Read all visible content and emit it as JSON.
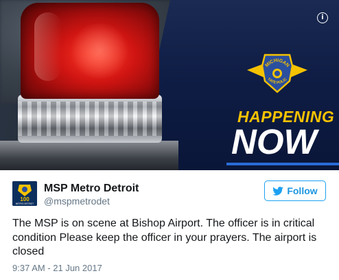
{
  "media": {
    "headline_top": "HAPPENING",
    "headline_bottom": "NOW",
    "patch": {
      "line1": "MICHIGAN",
      "line2": "STATE POLICE"
    },
    "colors": {
      "beacon_red": "#d11512",
      "headline_yellow": "#f5c200",
      "navy": "#0e1c44"
    }
  },
  "author": {
    "display_name": "MSP Metro Detroit",
    "handle": "@mspmetrodet",
    "avatar_icon": "msp-badge-icon",
    "avatar_text": "100",
    "avatar_caption": "METRO DETROIT"
  },
  "follow_button": {
    "label": "Follow",
    "icon": "twitter-bird-icon",
    "color": "#1da1f2"
  },
  "tweet": {
    "text": "The MSP is on scene at Bishop Airport. The officer is in critical condition Please keep the officer in your prayers. The airport is closed",
    "timestamp": "9:37 AM - 21 Jun 2017"
  },
  "info_icon": "info-icon"
}
